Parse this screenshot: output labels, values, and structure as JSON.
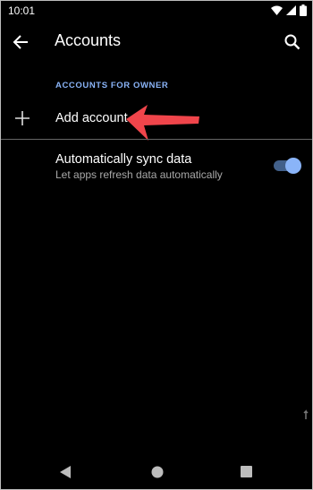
{
  "status_bar": {
    "time": "10:01",
    "icons": [
      "wifi-icon",
      "signal-icon",
      "battery-icon"
    ]
  },
  "app_bar": {
    "title": "Accounts",
    "back_icon": "arrow-back-icon",
    "search_icon": "search-icon"
  },
  "section": {
    "label": "ACCOUNTS FOR OWNER"
  },
  "add_account": {
    "icon": "plus-icon",
    "label": "Add account"
  },
  "annotation": {
    "icon": "red-arrow-icon",
    "color": "#f0454b"
  },
  "sync": {
    "title": "Automatically sync data",
    "subtitle": "Let apps refresh data automatically",
    "enabled": true
  },
  "nav_bar": {
    "icons": [
      "nav-back-icon",
      "nav-home-icon",
      "nav-recents-icon"
    ]
  },
  "colors": {
    "background": "#000000",
    "accent": "#8ab4f8",
    "annotation_red": "#f0454b"
  }
}
